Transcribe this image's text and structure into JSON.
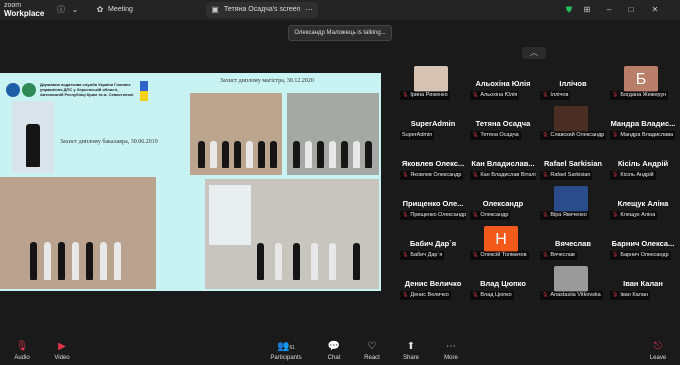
{
  "app": {
    "brand_line1": "zoom",
    "brand_line2": "Workplace"
  },
  "titlebar": {
    "meeting_label": "Meeting",
    "screen_tab_label": "Тетяна Осадча's screen"
  },
  "banner": {
    "talking": "Олександр Маложець is talking..."
  },
  "share": {
    "org_text": "Державна податкова служба України Головне управління ДПС у Херсонській області, Автономній Республіці Крим та м. Севастополі",
    "caption_master": "Захист диплому магістра, 30.12.2020",
    "caption_bachelor": "Захист диплому бакалавра, 30.06.2019"
  },
  "participants": [
    {
      "name": "",
      "sub": "Ірина Риженко",
      "pic": "photo"
    },
    {
      "name": "Альохіна Юлія",
      "sub": "Альохіна Юлія"
    },
    {
      "name": "Іллічов",
      "sub": "Іллічов"
    },
    {
      "name": "",
      "sub": "Богдана Жежерун",
      "pic": "letter",
      "letter": "Б"
    },
    {
      "name": "SuperAdmin",
      "sub": "SuperAdmin",
      "muted": false
    },
    {
      "name": "Тетяна Осадча",
      "sub": "Тетяна Осадча"
    },
    {
      "name": "",
      "sub": "Славский Олександр",
      "pic": "dark"
    },
    {
      "name": "Мандра  Владис...",
      "sub": "Мандра Владислава"
    },
    {
      "name": "Яковлев  Олекс...",
      "sub": "Яковлев Олександр"
    },
    {
      "name": "Кан  Владислав...",
      "sub": "Кан Владислав Віталій..."
    },
    {
      "name": "Rafael Sarkisian",
      "sub": "Rafael Sarkisian"
    },
    {
      "name": "Кісіль Андрій",
      "sub": "Кісіль Андрій"
    },
    {
      "name": "Прищенко  Оле...",
      "sub": "Прищенко Олександр"
    },
    {
      "name": "Олександр",
      "sub": "Олександр"
    },
    {
      "name": "",
      "sub": "Віра Якиченко",
      "pic": "blue"
    },
    {
      "name": "Клещук Аліна",
      "sub": "Клещук Аліна"
    },
    {
      "name": "Бабич Дар`я",
      "sub": "Бабич Дар`я"
    },
    {
      "name": "",
      "sub": "Олексій Толмачов",
      "pic": "letterH",
      "letter": "Н"
    },
    {
      "name": "Вячеслав",
      "sub": "Вячеслав"
    },
    {
      "name": "Барнич  Олекса...",
      "sub": "Барнич Олександр"
    },
    {
      "name": "Денис Величко",
      "sub": "Денис Величко"
    },
    {
      "name": "Влад Цюпко",
      "sub": "Влад Цюпко"
    },
    {
      "name": "",
      "sub": "Anastasiia Vitkovska",
      "pic": "gray"
    },
    {
      "name": "Іван Калан",
      "sub": "Іван Калан"
    }
  ],
  "toolbar": {
    "audio": "Audio",
    "video": "Video",
    "participants": "Participants",
    "participants_count": "61",
    "chat": "Chat",
    "react": "React",
    "share": "Share",
    "more": "More",
    "leave": "Leave"
  },
  "colors": {
    "muted_mic": "#e0344b",
    "share_bg": "#c9f2f3",
    "accent_green": "#21c15b"
  }
}
